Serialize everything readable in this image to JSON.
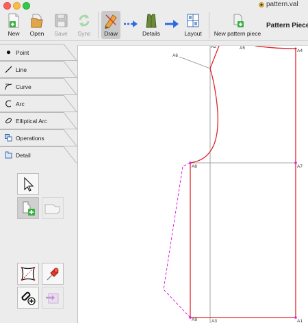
{
  "window": {
    "title": "pattern.val"
  },
  "toolbar": {
    "new_label": "New",
    "open_label": "Open",
    "save_label": "Save",
    "sync_label": "Sync",
    "draw_label": "Draw",
    "details_label": "Details",
    "layout_label": "Layout",
    "new_piece_label": "New pattern piece",
    "pattern_pieces_label": "Pattern Piece"
  },
  "tool_tabs": [
    {
      "label": "Point",
      "icon": "point-icon"
    },
    {
      "label": "Line",
      "icon": "line-icon"
    },
    {
      "label": "Curve",
      "icon": "curve-icon"
    },
    {
      "label": "Arc",
      "icon": "arc-icon"
    },
    {
      "label": "Elliptical Arc",
      "icon": "elliptical-arc-icon"
    },
    {
      "label": "Operations",
      "icon": "operations-icon"
    },
    {
      "label": "Detail",
      "icon": "detail-icon"
    }
  ],
  "detail_tools": [
    {
      "name": "pointer-tool",
      "icon": "pointer-icon",
      "selected": false
    },
    {
      "name": "new-detail-tool",
      "icon": "detail-add-icon",
      "selected": true
    },
    {
      "name": "union-tool",
      "icon": "union-icon",
      "selected": false
    },
    {
      "name": "seam-allowance-tool",
      "icon": "seam-allowance-icon",
      "selected": false
    },
    {
      "name": "pin-tool",
      "icon": "pin-icon",
      "selected": false
    },
    {
      "name": "insert-node-tool",
      "icon": "insert-node-icon",
      "selected": false
    },
    {
      "name": "export-tool",
      "icon": "export-icon",
      "selected": false
    }
  ],
  "canvas": {
    "point_labels": {
      "a1": "A1",
      "a2": "A2",
      "a3": "A3",
      "a4": "A4",
      "a5": "A5",
      "a6": "A6",
      "a7": "A7",
      "a8": "A8",
      "a9": "A9"
    }
  },
  "colors": {
    "pattern_line": "#e0222a",
    "construction_line": "#8a8a8a",
    "seam_allowance": "#e020e0",
    "toolbar_arrow": "#2d6be0"
  }
}
